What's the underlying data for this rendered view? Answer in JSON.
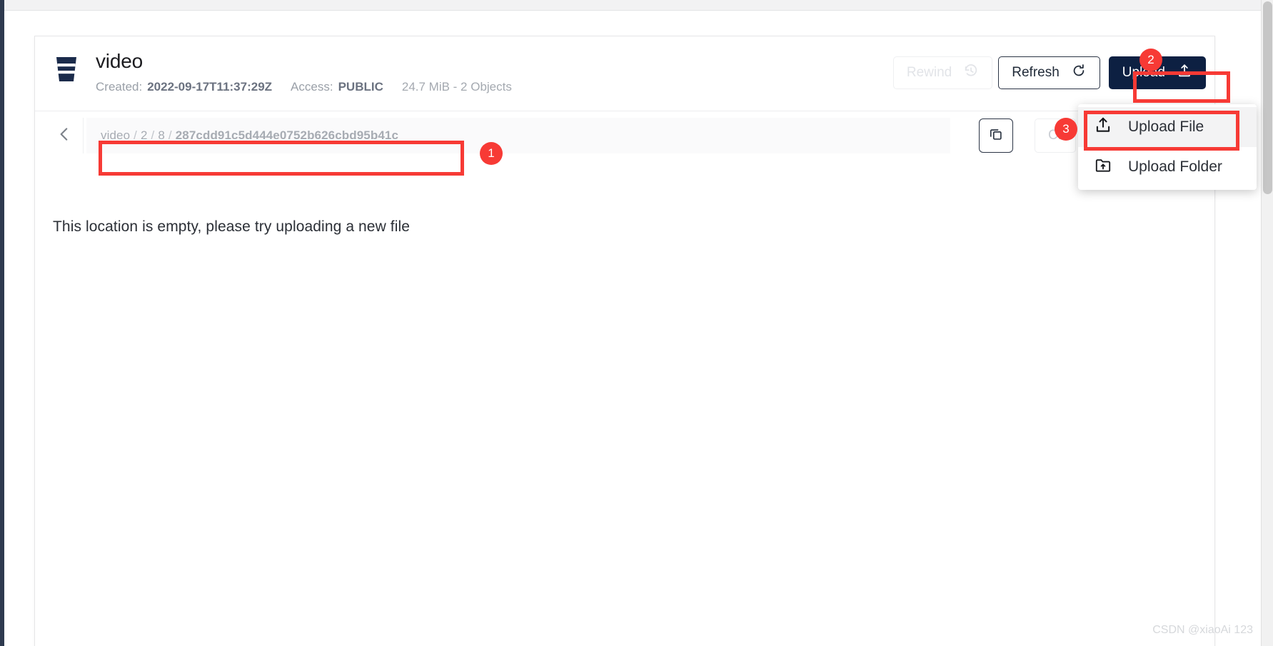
{
  "bucket": {
    "name": "video",
    "icon": "bucket-icon",
    "created_label": "Created:",
    "created_value": "2022-09-17T11:37:29Z",
    "access_label": "Access:",
    "access_value": "PUBLIC",
    "size_objects": "24.7 MiB - 2 Objects"
  },
  "header_actions": {
    "rewind_label": "Rewind",
    "rewind_icon": "history-rewind-icon",
    "rewind_disabled": true,
    "refresh_label": "Refresh",
    "refresh_icon": "refresh-icon",
    "upload_label": "Upload",
    "upload_icon": "upload-arrow-icon"
  },
  "breadcrumb": {
    "back_icon": "chevron-left-icon",
    "root": "video",
    "segments": [
      "2",
      "8"
    ],
    "leaf": "287cdd91c5d444e0752b626cbd95b41c",
    "separator": "/",
    "copy_icon": "copy-icon",
    "create_label": "Cr"
  },
  "content": {
    "empty_message": "This location is empty, please try uploading a new file"
  },
  "dropdown": {
    "items": [
      {
        "label": "Upload File",
        "icon": "upload-file-icon",
        "active": true
      },
      {
        "label": "Upload Folder",
        "icon": "upload-folder-icon",
        "active": false
      }
    ]
  },
  "annotations": {
    "badge_1": "1",
    "badge_2": "2",
    "badge_3": "3",
    "color": "#f73a35"
  },
  "watermark": {
    "text": "CSDN @xiaoAi 123"
  },
  "colors": {
    "navy": "#0d2042",
    "accent_red": "#f73a35",
    "muted_text": "#9aa0a8"
  }
}
